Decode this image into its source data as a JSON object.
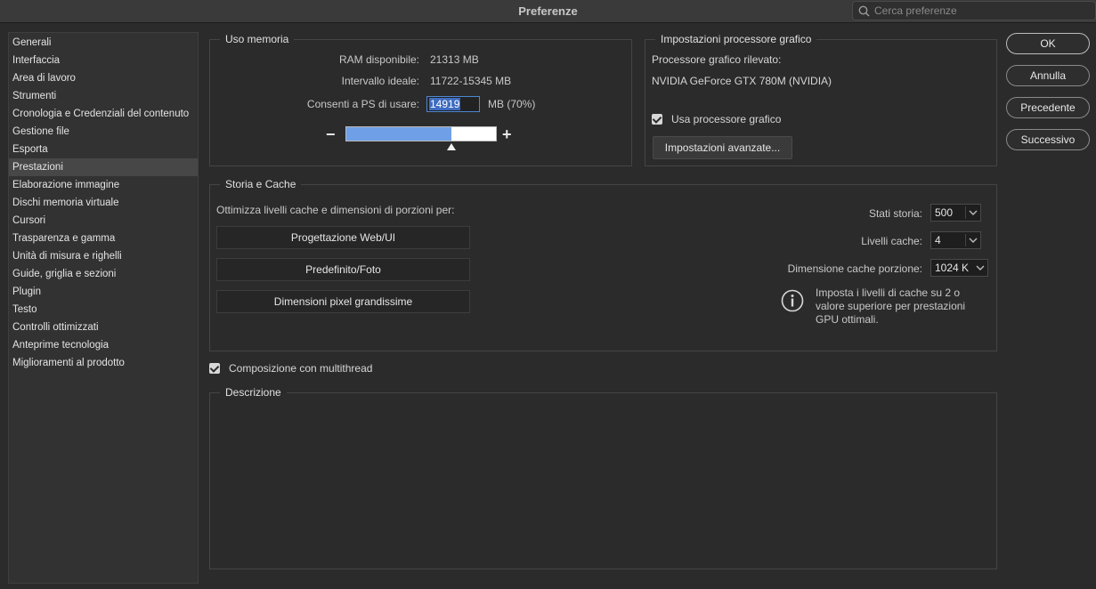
{
  "window": {
    "title": "Preferenze"
  },
  "search": {
    "placeholder": "Cerca preferenze"
  },
  "sidebar": {
    "items": [
      {
        "label": "Generali"
      },
      {
        "label": "Interfaccia"
      },
      {
        "label": "Area di lavoro"
      },
      {
        "label": "Strumenti"
      },
      {
        "label": "Cronologia e Credenziali del contenuto"
      },
      {
        "label": "Gestione file"
      },
      {
        "label": "Esporta"
      },
      {
        "label": "Prestazioni",
        "selected": true
      },
      {
        "label": "Elaborazione immagine"
      },
      {
        "label": "Dischi memoria virtuale"
      },
      {
        "label": "Cursori"
      },
      {
        "label": "Trasparenza e gamma"
      },
      {
        "label": "Unità di misura e righelli"
      },
      {
        "label": "Guide, griglia e sezioni"
      },
      {
        "label": "Plugin"
      },
      {
        "label": "Testo"
      },
      {
        "label": "Controlli ottimizzati"
      },
      {
        "label": "Anteprime tecnologia"
      },
      {
        "label": "Miglioramenti al prodotto"
      }
    ]
  },
  "memory": {
    "group_label": "Uso memoria",
    "ram_label": "RAM disponibile:",
    "ram_value": "21313 MB",
    "range_label": "Intervallo ideale:",
    "range_value": "11722-15345 MB",
    "allow_label": "Consenti a PS di usare:",
    "allow_value": "14919",
    "allow_unit": "MB (70%)",
    "slider_fraction": 0.7,
    "minus": "−",
    "plus": "+"
  },
  "gpu": {
    "group_label": "Impostazioni processore grafico",
    "detected_label": "Processore grafico rilevato:",
    "detected_value": "NVIDIA GeForce GTX 780M (NVIDIA)",
    "use_gpu_label": "Usa processore grafico",
    "use_gpu_checked": true,
    "advanced_button": "Impostazioni avanzate..."
  },
  "history_cache": {
    "group_label": "Storia e Cache",
    "optimize_label": "Ottimizza livelli cache e dimensioni di porzioni per:",
    "preset_buttons": [
      "Progettazione Web/UI",
      "Predefinito/Foto",
      "Dimensioni pixel grandissime"
    ],
    "history_states_label": "Stati storia:",
    "history_states_value": "500",
    "cache_levels_label": "Livelli cache:",
    "cache_levels_value": "4",
    "tile_size_label": "Dimensione cache porzione:",
    "tile_size_value": "1024 K",
    "info_text": "Imposta i livelli di cache su 2 o valore superiore per prestazioni GPU ottimali."
  },
  "multithread": {
    "label": "Composizione con multithread",
    "checked": true
  },
  "description": {
    "group_label": "Descrizione"
  },
  "buttons": {
    "ok": "OK",
    "cancel": "Annulla",
    "prev": "Precedente",
    "next": "Successivo"
  }
}
